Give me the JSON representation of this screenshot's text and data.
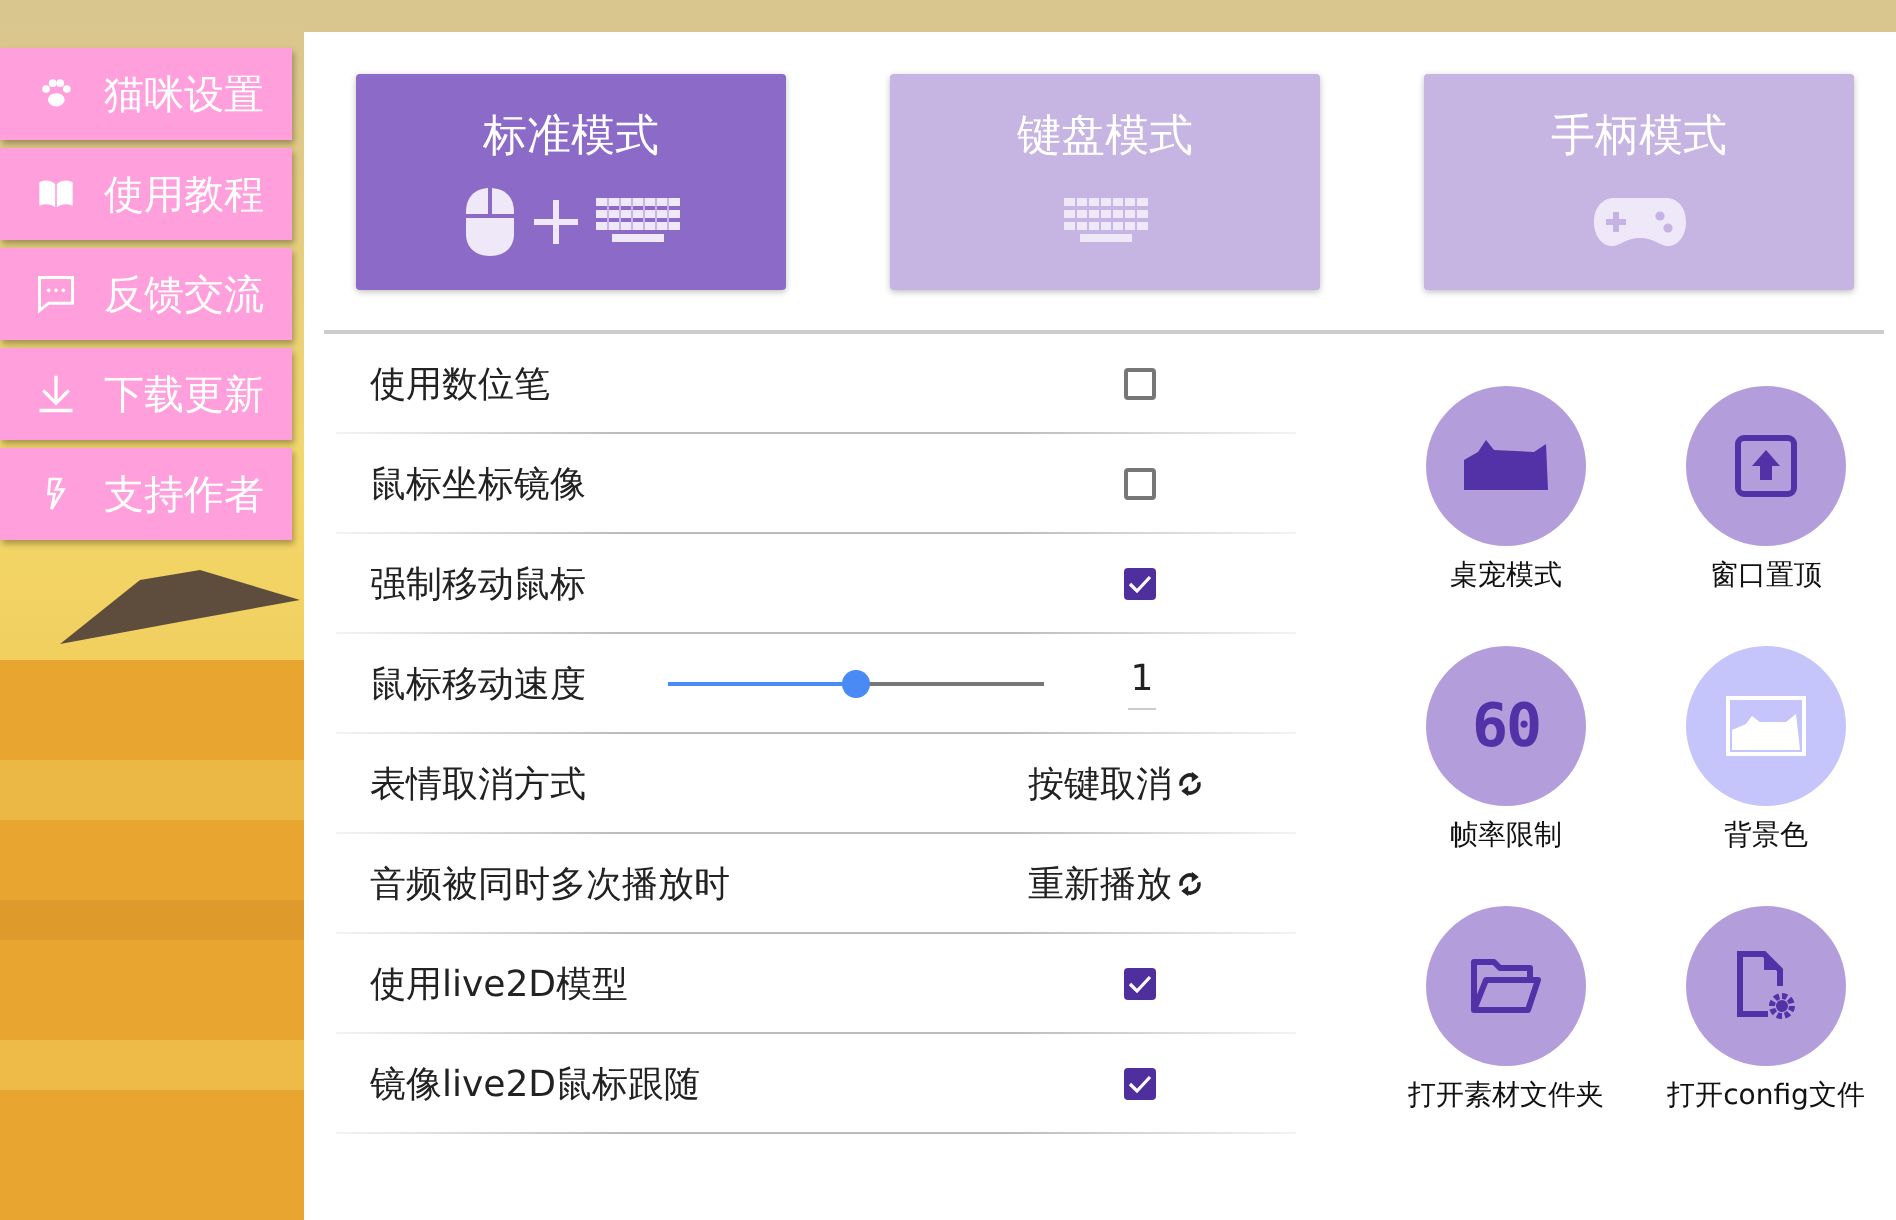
{
  "sidebar": {
    "items": [
      {
        "label": "猫咪设置"
      },
      {
        "label": "使用教程"
      },
      {
        "label": "反馈交流"
      },
      {
        "label": "下载更新"
      },
      {
        "label": "支持作者"
      }
    ]
  },
  "modes": [
    {
      "label": "标准模式",
      "selected": true
    },
    {
      "label": "键盘模式",
      "selected": false
    },
    {
      "label": "手柄模式",
      "selected": false
    }
  ],
  "settings": [
    {
      "kind": "checkbox",
      "label": "使用数位笔",
      "checked": false
    },
    {
      "kind": "checkbox",
      "label": "鼠标坐标镜像",
      "checked": false
    },
    {
      "kind": "checkbox",
      "label": "强制移动鼠标",
      "checked": true
    },
    {
      "kind": "slider",
      "label": "鼠标移动速度",
      "level": 0.5,
      "value": "1"
    },
    {
      "kind": "cycle",
      "label": "表情取消方式",
      "value": "按键取消"
    },
    {
      "kind": "cycle",
      "label": "音频被同时多次播放时",
      "value": "重新播放"
    },
    {
      "kind": "checkbox",
      "label": "使用live2D模型",
      "checked": true
    },
    {
      "kind": "checkbox",
      "label": "镜像live2D鼠标跟随",
      "checked": true
    }
  ],
  "tools": [
    {
      "label": "桌宠模式",
      "color": "#b39ddb"
    },
    {
      "label": "窗口置顶",
      "color": "#b39ddb"
    },
    {
      "label": "帧率限制",
      "icon_text": "60",
      "color": "#b39ddb"
    },
    {
      "label": "背景色",
      "color": "#c5c5fb"
    },
    {
      "label": "打开素材文件夹",
      "color": "#b39ddb"
    },
    {
      "label": "打开config文件",
      "color": "#b39ddb"
    }
  ]
}
